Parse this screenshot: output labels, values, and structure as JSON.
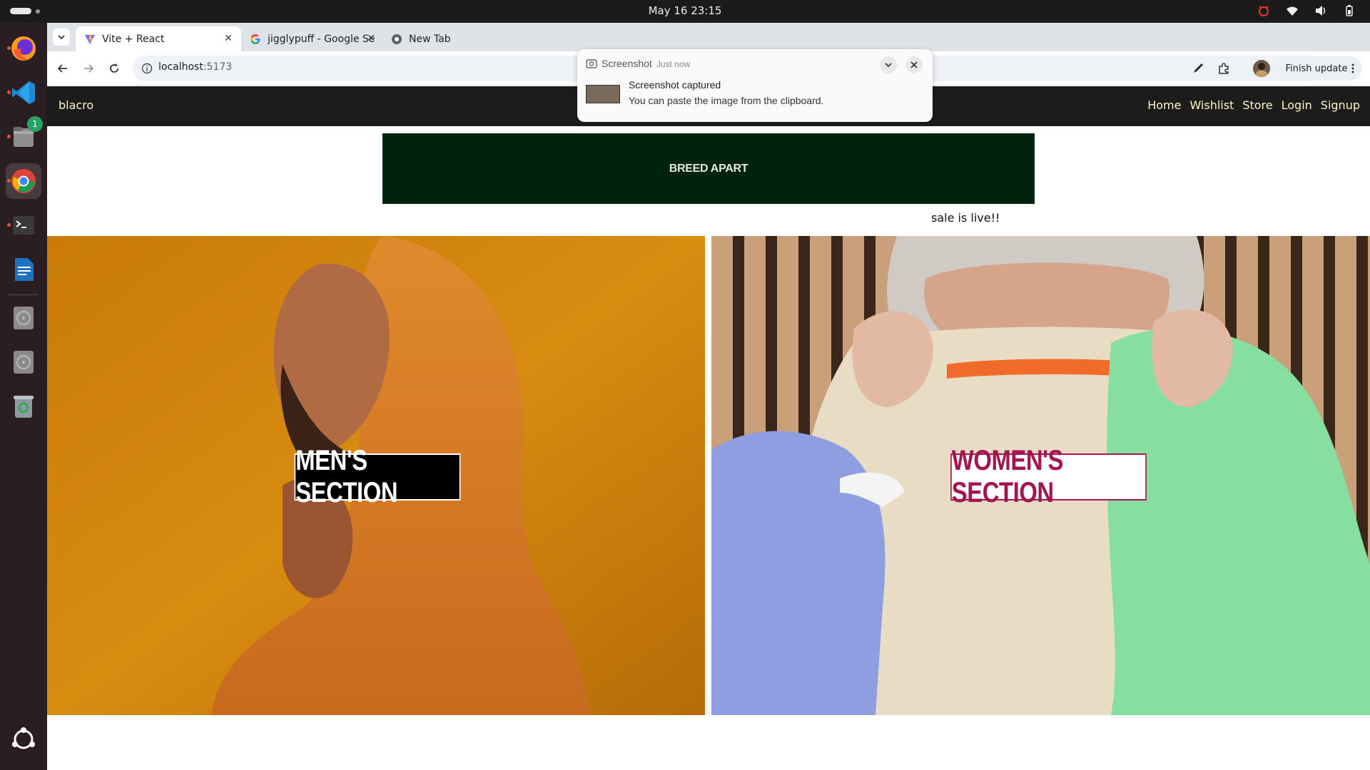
{
  "system": {
    "clock": "May 16  23:15"
  },
  "dock": {
    "files_badge": "1"
  },
  "browser": {
    "tabs": [
      {
        "title": "Vite + React",
        "icon": "vite-icon"
      },
      {
        "title": "jigglypuff - Google Searc",
        "icon": "google-icon"
      },
      {
        "title": "New Tab",
        "icon": "chrome-icon"
      }
    ],
    "url_host": "localhost",
    "url_port": ":5173",
    "finish_update": "Finish update"
  },
  "notification": {
    "app": "Screenshot",
    "time": "Just now",
    "title": "Screenshot captured",
    "body": "You can paste the image from the clipboard."
  },
  "site": {
    "brand": "blacro",
    "nav": [
      "Home",
      "Wishlist",
      "Store",
      "Login",
      "Signup"
    ],
    "banner": "BREED APART",
    "marquee": "sale is live!!",
    "men_label": "MEN'S SECTION",
    "women_label": "WOMEN'S SECTION"
  },
  "colors": {
    "navbar": "#1c1c1c",
    "nav_text": "#fff3c8",
    "banner_bg": "#00230f",
    "women_accent": "#a31450"
  }
}
